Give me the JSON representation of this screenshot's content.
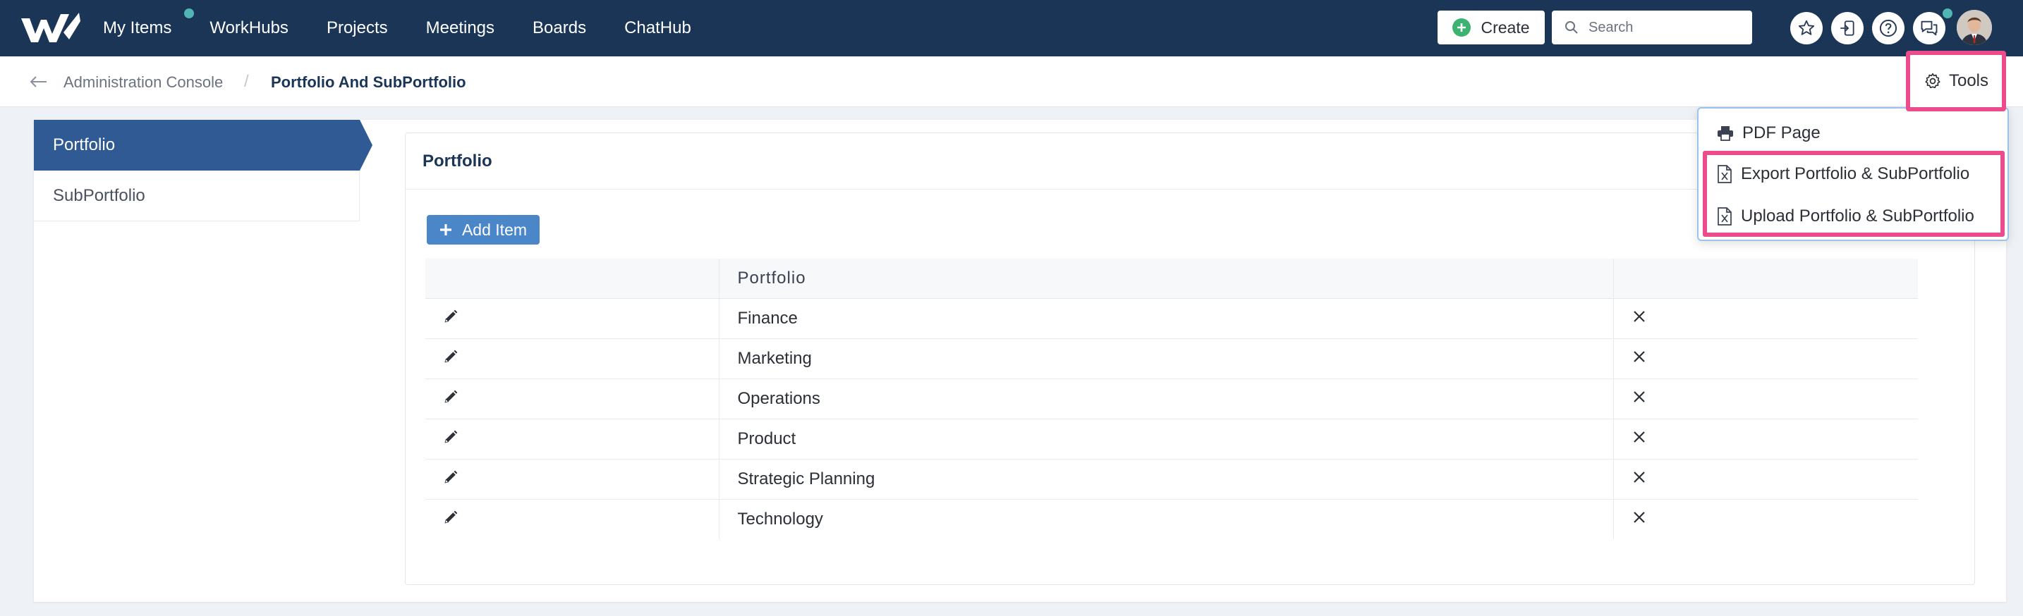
{
  "colors": {
    "topbar": "#1b3557",
    "accent_blue": "#2f5a94",
    "button_blue": "#4a86c8",
    "highlight_pink": "#ec4c8b",
    "create_green": "#3cb371",
    "notification_teal": "#4fb6b4"
  },
  "topnav": {
    "items": [
      {
        "label": "My Items",
        "has_badge": true
      },
      {
        "label": "WorkHubs"
      },
      {
        "label": "Projects"
      },
      {
        "label": "Meetings"
      },
      {
        "label": "Boards"
      },
      {
        "label": "ChatHub"
      }
    ],
    "create_label": "Create",
    "search_placeholder": "Search",
    "icons": [
      "star-icon",
      "sign-in-icon",
      "help-icon",
      "chat-icon",
      "user-avatar"
    ]
  },
  "breadcrumb": {
    "parent": "Administration Console",
    "separator": "/",
    "current": "Portfolio And SubPortfolio"
  },
  "tools": {
    "label": "Tools",
    "menu": [
      {
        "label": "PDF Page",
        "icon": "print-icon"
      },
      {
        "label": "Export Portfolio & SubPortfolio",
        "icon": "excel-file-icon"
      },
      {
        "label": "Upload Portfolio & SubPortfolio",
        "icon": "excel-file-icon"
      }
    ]
  },
  "sidebar": {
    "items": [
      {
        "label": "Portfolio",
        "active": true
      },
      {
        "label": "SubPortfolio",
        "active": false
      }
    ]
  },
  "card": {
    "title": "Portfolio",
    "add_label": "Add Item",
    "table": {
      "columns": [
        "",
        "Portfolio",
        ""
      ],
      "rows": [
        "Finance",
        "Marketing",
        "Operations",
        "Product",
        "Strategic Planning",
        "Technology"
      ]
    }
  }
}
